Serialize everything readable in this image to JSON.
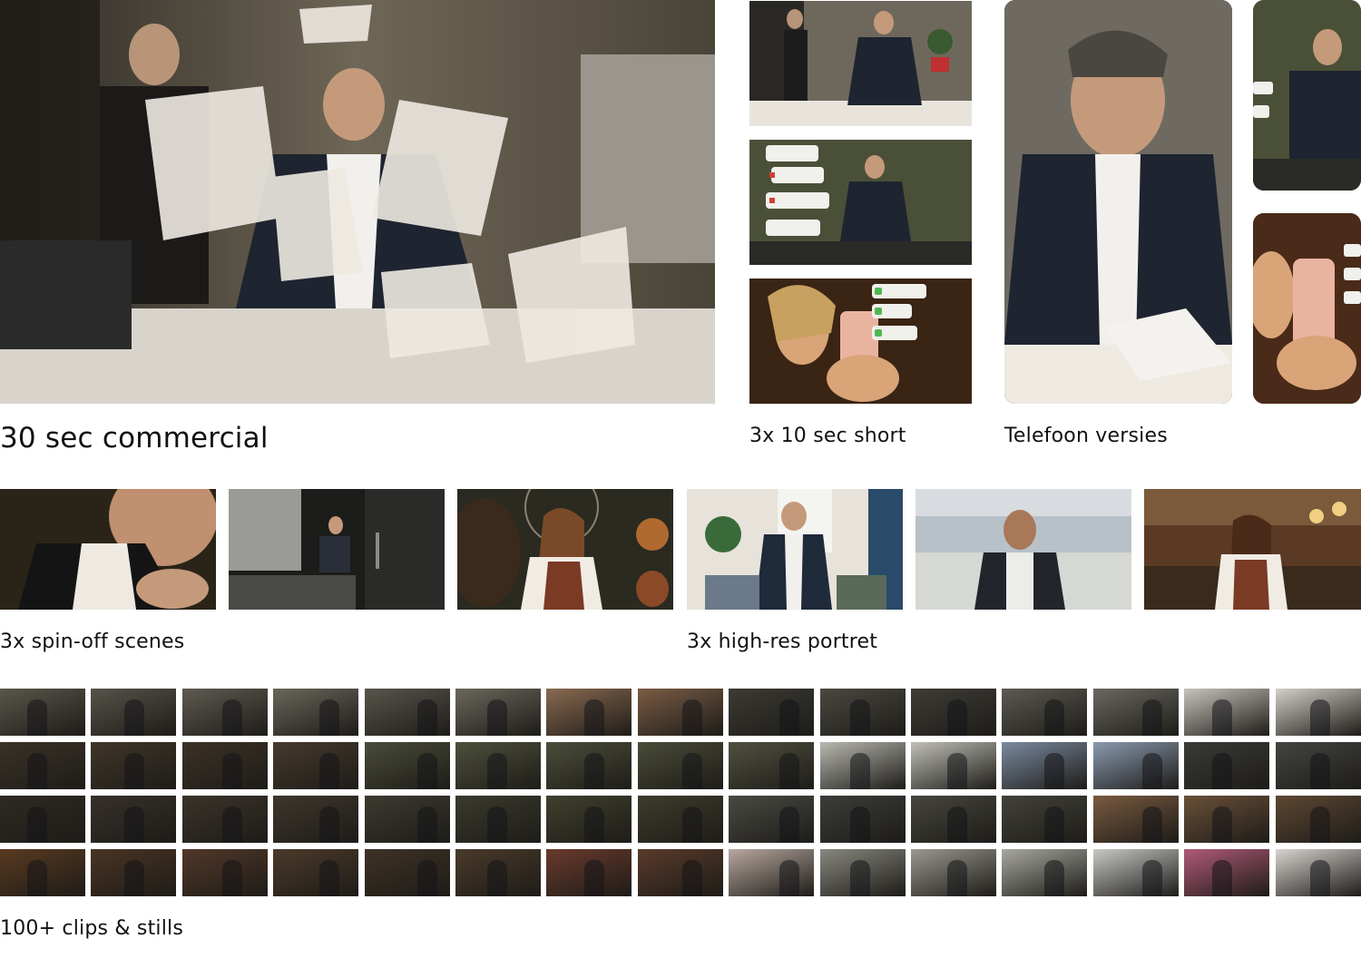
{
  "sections": {
    "commercial": {
      "label": "30 sec commercial"
    },
    "shorts": {
      "label": "3x 10 sec short"
    },
    "phone": {
      "label": "Telefoon versies"
    },
    "spinoff": {
      "label": "3x spin-off scenes"
    },
    "portrait": {
      "label": "3x high-res portret"
    },
    "clips": {
      "label": "100+ clips & stills"
    }
  },
  "tiles": {
    "hero": {
      "name": "office-paper-storm-still",
      "colors": [
        "#3b352c",
        "#8a7f6a",
        "#d9d4c8"
      ]
    },
    "shorts": [
      {
        "name": "short-office-papers",
        "colors": [
          "#4a453d",
          "#9c9380",
          "#e6e2d8"
        ]
      },
      {
        "name": "short-notifications-desk",
        "colors": [
          "#3f4632",
          "#6f7650",
          "#2a2c24"
        ]
      },
      {
        "name": "short-woman-phone-messages",
        "colors": [
          "#3a2616",
          "#8a5a2c",
          "#d8a86a"
        ]
      }
    ],
    "phone": [
      {
        "name": "phone-man-papers",
        "colors": [
          "#5a574f",
          "#b9b3a6",
          "#ece8e0"
        ]
      },
      {
        "name": "phone-man-desk-notifications",
        "colors": [
          "#3f4632",
          "#6f7650",
          "#d6d6d0"
        ]
      },
      {
        "name": "phone-woman-smartphone",
        "colors": [
          "#3a2414",
          "#9a6030",
          "#e8b08a"
        ]
      }
    ],
    "spinoff": [
      {
        "name": "spinoff-man-thinking",
        "colors": [
          "#2a2418",
          "#6a5a40",
          "#c9a07a"
        ]
      },
      {
        "name": "spinoff-office-doorway",
        "colors": [
          "#1c1c1a",
          "#6a6a66",
          "#d0d0cc"
        ]
      },
      {
        "name": "spinoff-woman-cafe",
        "colors": [
          "#2a2a20",
          "#8a6440",
          "#e2b07c"
        ]
      }
    ],
    "portrait": [
      {
        "name": "portrait-businessman-office",
        "colors": [
          "#e7e3da",
          "#1f2a3a",
          "#6e8a6e"
        ]
      },
      {
        "name": "portrait-man-factory",
        "colors": [
          "#b8c0c8",
          "#22262c",
          "#e6e6e2"
        ]
      },
      {
        "name": "portrait-woman-bar",
        "colors": [
          "#5a3a24",
          "#8a5a3a",
          "#d8b890"
        ]
      }
    ]
  },
  "clip_grid": {
    "rows": [
      [
        "#5a564c",
        "#57534a",
        "#5f5b52",
        "#6a665c",
        "#58554c",
        "#6b675d",
        "#8a6a50",
        "#7a5c44",
        "#3c3a34",
        "#4a4840",
        "#3e3c36",
        "#5c5a52",
        "#6a6860",
        "#c8c4bc",
        "#d4d0c8"
      ],
      [
        "#3a3228",
        "#40362a",
        "#3c3226",
        "#463a2e",
        "#4a4c3a",
        "#4e503c",
        "#4c4e3a",
        "#4a4c38",
        "#505040",
        "#b8b8b0",
        "#c0c0b8",
        "#7a8aa0",
        "#8a9ab0",
        "#3a3a38",
        "#444440"
      ],
      [
        "#2e2a22",
        "#36302a",
        "#3a332a",
        "#3e362c",
        "#3c3a30",
        "#3a3a2e",
        "#40402e",
        "#3e3c2c",
        "#4a4a44",
        "#3c3c38",
        "#46463e",
        "#42423a",
        "#7a5a40",
        "#6a5038",
        "#5e4832"
      ],
      [
        "#5a3a20",
        "#4a3424",
        "#523828",
        "#4c3a2a",
        "#3e3226",
        "#4a3a2a",
        "#6a3a2c",
        "#5a3a2a",
        "#b8a8a0",
        "#888880",
        "#9a9890",
        "#a8a8a0",
        "#c8c8c4",
        "#b05a78",
        "#d8d4d0"
      ]
    ]
  }
}
